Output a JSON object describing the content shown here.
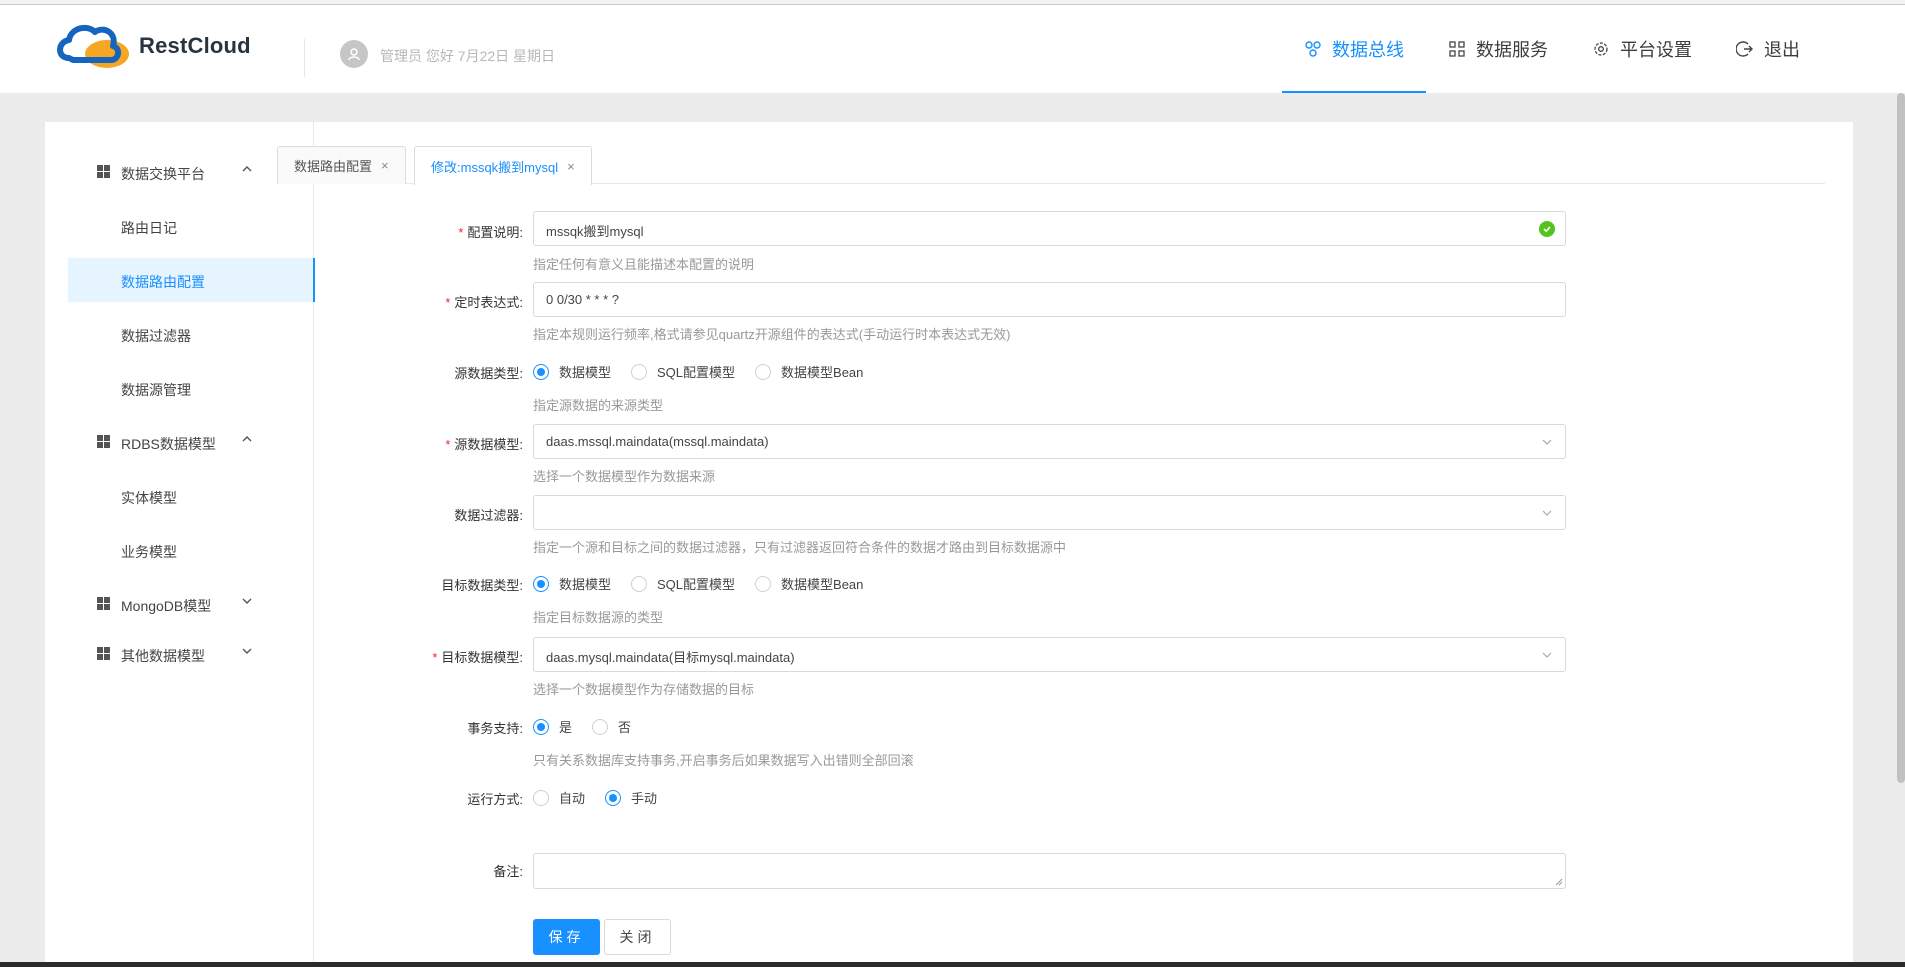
{
  "header": {
    "logo_text": "RestCloud",
    "welcome": "管理员 您好 7月22日 星期日",
    "nav": [
      {
        "label": "数据总线",
        "icon": "bus-icon",
        "active": true
      },
      {
        "label": "数据服务",
        "icon": "grid-icon",
        "active": false
      },
      {
        "label": "平台设置",
        "icon": "gear-icon",
        "active": false
      },
      {
        "label": "退出",
        "icon": "logout-icon",
        "active": false
      }
    ]
  },
  "sidebar": {
    "groups": [
      {
        "label": "数据交换平台",
        "expanded": true
      },
      {
        "label": "RDBS数据模型",
        "expanded": true
      },
      {
        "label": "MongoDB模型",
        "expanded": false
      },
      {
        "label": "其他数据模型",
        "expanded": false
      }
    ],
    "items": [
      {
        "label": "路由日记"
      },
      {
        "label": "数据路由配置",
        "active": true
      },
      {
        "label": "数据过滤器"
      },
      {
        "label": "数据源管理"
      },
      {
        "label": "实体模型"
      },
      {
        "label": "业务模型"
      }
    ]
  },
  "tabs": [
    {
      "label": "数据路由配置",
      "close": "×"
    },
    {
      "label": "修改:mssqk搬到mysql",
      "close": "×",
      "active": true
    }
  ],
  "form": {
    "config_desc": {
      "label": "配置说明:",
      "value": "mssqk搬到mysql",
      "help": "指定任何有意义且能描述本配置的说明"
    },
    "cron": {
      "label": "定时表达式:",
      "value": "0 0/30 * * * ?",
      "help": "指定本规则运行频率,格式请参见quartz开源组件的表达式(手动运行时本表达式无效)"
    },
    "source_type": {
      "label": "源数据类型:",
      "options": [
        "数据模型",
        "SQL配置模型",
        "数据模型Bean"
      ],
      "selected": "数据模型",
      "help": "指定源数据的来源类型"
    },
    "source_model": {
      "label": "源数据模型:",
      "value": "daas.mssql.maindata(mssql.maindata)",
      "help": "选择一个数据模型作为数据来源"
    },
    "filter": {
      "label": "数据过滤器:",
      "value": "",
      "help": "指定一个源和目标之间的数据过滤器，只有过滤器返回符合条件的数据才路由到目标数据源中"
    },
    "target_type": {
      "label": "目标数据类型:",
      "options": [
        "数据模型",
        "SQL配置模型",
        "数据模型Bean"
      ],
      "selected": "数据模型",
      "help": "指定目标数据源的类型"
    },
    "target_model": {
      "label": "目标数据模型:",
      "value": "daas.mysql.maindata(目标mysql.maindata)",
      "help": "选择一个数据模型作为存储数据的目标"
    },
    "transaction": {
      "label": "事务支持:",
      "options": [
        "是",
        "否"
      ],
      "selected": "是",
      "help": "只有关系数据库支持事务,开启事务后如果数据写入出错则全部回滚"
    },
    "run_mode": {
      "label": "运行方式:",
      "options": [
        "自动",
        "手动"
      ],
      "selected": "手动"
    },
    "remark": {
      "label": "备注:",
      "value": ""
    },
    "save_label": "保存",
    "close_label": "关闭"
  }
}
